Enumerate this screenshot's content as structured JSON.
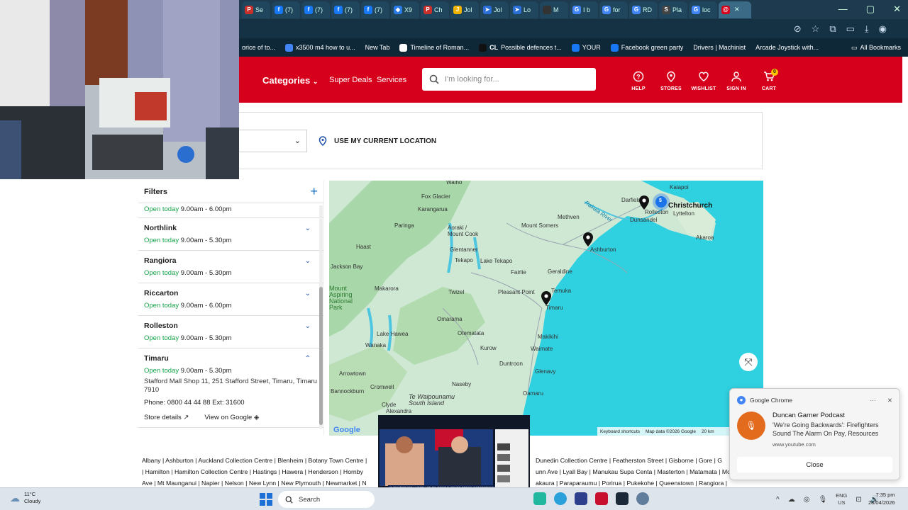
{
  "browser": {
    "tabs": [
      {
        "label": "Se",
        "color": "#c9302c",
        "icon": "P"
      },
      {
        "label": "(7)",
        "color": "#1877f2",
        "icon": "f"
      },
      {
        "label": "(7)",
        "color": "#1877f2",
        "icon": "f"
      },
      {
        "label": "(7)",
        "color": "#1877f2",
        "icon": "f"
      },
      {
        "label": "(7)",
        "color": "#1877f2",
        "icon": "f"
      },
      {
        "label": "X9",
        "color": "#2b7be4",
        "icon": "◆"
      },
      {
        "label": "Ch",
        "color": "#c9302c",
        "icon": "P"
      },
      {
        "label": "Jol",
        "color": "#f0b400",
        "icon": "J"
      },
      {
        "label": "Jol",
        "color": "#2b6fd6",
        "icon": "➤"
      },
      {
        "label": "Lo",
        "color": "#2b6fd6",
        "icon": "➤"
      },
      {
        "label": "M",
        "color": "#333333",
        "icon": ""
      },
      {
        "label": "I b",
        "color": "#4285f4",
        "icon": "G"
      },
      {
        "label": "for",
        "color": "#4285f4",
        "icon": "G"
      },
      {
        "label": "RD",
        "color": "#4285f4",
        "icon": "G"
      },
      {
        "label": "Pla",
        "color": "#444444",
        "icon": "S"
      },
      {
        "label": "loc",
        "color": "#4285f4",
        "icon": "G"
      },
      {
        "label": "",
        "color": "#d6001c",
        "icon": "@"
      }
    ],
    "bookmarks": [
      {
        "label": "orice of to...",
        "color": ""
      },
      {
        "label": "x3500 m4 how to u...",
        "color": "#4285f4"
      },
      {
        "label": "New Tab",
        "color": ""
      },
      {
        "label": "Timeline of Roman...",
        "color": "#ffffff"
      },
      {
        "label": "Possible defences t...",
        "color": "#111111"
      },
      {
        "label": "YOUR",
        "color": "#1877f2"
      },
      {
        "label": "Facebook green party",
        "color": "#1877f2"
      },
      {
        "label": "Drivers | Machinist",
        "color": ""
      },
      {
        "label": "Arcade Joystick with...",
        "color": ""
      }
    ],
    "all_bookmarks": "All Bookmarks",
    "cl_text": "CL"
  },
  "header": {
    "categories": "Categories",
    "super_deals": "Super Deals",
    "services": "Services",
    "search_placeholder": "I'm looking for...",
    "icons": [
      {
        "label": "HELP",
        "icon": "help-icon"
      },
      {
        "label": "STORES",
        "icon": "stores-icon"
      },
      {
        "label": "WISHLIST",
        "icon": "wishlist-icon"
      },
      {
        "label": "SIGN IN",
        "icon": "user-icon"
      },
      {
        "label": "CART",
        "icon": "cart-icon"
      }
    ],
    "cart_count": "0"
  },
  "location": {
    "use_current": "USE MY CURRENT LOCATION"
  },
  "filters": {
    "label": "Filters"
  },
  "stores": {
    "first_hours": "9.00am - 6.00pm",
    "open_today": "Open today",
    "list": [
      {
        "name": "Northlink",
        "hours": "9.00am - 5.30pm"
      },
      {
        "name": "Rangiora",
        "hours": "9.00am - 5.30pm"
      },
      {
        "name": "Riccarton",
        "hours": "9.00am - 6.00pm"
      },
      {
        "name": "Rolleston",
        "hours": "9.00am - 5.30pm"
      }
    ],
    "expanded": {
      "name": "Timaru",
      "hours": "9.00am - 5.30pm",
      "address": "Stafford Mall Shop 11, 251 Stafford Street, Timaru, Timaru 7910",
      "phone": "Phone: 0800 44 44 88 Ext: 31600",
      "store_details": "Store details",
      "view_google": "View on Google"
    }
  },
  "map": {
    "labels": [
      "Waiho",
      "Fox Glacier",
      "Karangarua",
      "Paringa",
      "Haast",
      "Aoraki / Mount Cook",
      "Glentanner",
      "Tekapo",
      "Lake Tekapo",
      "Fairlie",
      "Jackson Bay",
      "Makarora",
      "Twizel",
      "Omarama",
      "Otematata",
      "Lake Hawea",
      "Wanaka",
      "Kurow",
      "Duntroon",
      "Arrowtown",
      "Cromwell",
      "Bannockburn",
      "Clyde",
      "Alexandra",
      "Naseby",
      "Oamaru",
      "Waimate",
      "Makikihi",
      "Temuka",
      "Timaru",
      "Pleasant Point",
      "Geraldine",
      "Ashburton",
      "Methven",
      "Mount Somers",
      "Darfield",
      "Rolleston",
      "Dunsandel",
      "Christchurch",
      "Lyttelton",
      "Kaiapoi",
      "Akaroa",
      "Glenavy",
      "Rakaia River",
      "Mount Aspiring National Park",
      "Te Waipounamu South Island"
    ],
    "cluster_count": "5",
    "footer_shortcuts": "Keyboard shortcuts",
    "footer_data": "Map data ©2026 Google",
    "footer_scale": "20 km",
    "google": "Google"
  },
  "store_links": [
    "Albany | Ashburton | Auckland Collection Centre | Blenheim | Botany Town Centre |",
    "Dunedin Collection Centre | Featherston Street | Gisborne | Gore | G",
    "| Hamilton | Hamilton Collection Centre | Hastings | Hawera | Henderson | Hornby",
    "unn Ave | Lyall Bay | Manukau Supa Centa | Masterton | Matamata | Mo",
    "Ave | Mt Maunganui | Napier | Nelson | New Lynn | New Plymouth | Newmarket | N",
    "akaura | Paraparaumu | Porirua | Pukekohe | Queenstown | Rangiora | Riccarton |"
  ],
  "video": {
    "caption": "CHRISTOPHER LUXON HOLDS POST-CABINET PRESS CONFERENCE"
  },
  "notification": {
    "app": "Google Chrome",
    "title": "Duncan Garner Podcast",
    "message": "'We're Going Backwards': Firefighters Sound The Alarm On Pay, Resources",
    "source": "www.youtube.com",
    "close": "Close"
  },
  "taskbar": {
    "temp": "11°C",
    "weather": "Cloudy",
    "search": "Search",
    "lang1": "ENG",
    "lang2": "US",
    "time": "7:35 pm",
    "date": "28/04/2026"
  }
}
